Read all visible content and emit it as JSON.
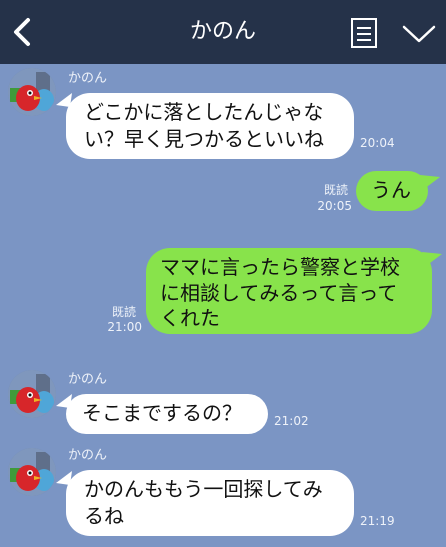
{
  "header": {
    "title": "かのん",
    "back_icon": "chevron-left-icon",
    "menu_icon": "list-icon",
    "collapse_icon": "chevron-down-icon",
    "background": "#253249"
  },
  "chat": {
    "background": "#7b95c4",
    "incoming_bubble_color": "#ffffff",
    "outgoing_bubble_color": "#88e34b",
    "messages": [
      {
        "direction": "in",
        "sender": "かのん",
        "lines": [
          "どこかに落としたんじゃな",
          "い？早く見つかるといいね"
        ],
        "time": "20:04"
      },
      {
        "direction": "out",
        "read": "既読",
        "lines": [
          "うん"
        ],
        "time": "20:05"
      },
      {
        "direction": "out",
        "read": "既読",
        "lines": [
          "ママに言ったら警察と学校",
          "に相談してみるって言って",
          "くれた"
        ],
        "time": "21:00"
      },
      {
        "direction": "in",
        "sender": "かのん",
        "lines": [
          "そこまでするの？"
        ],
        "time": "21:02"
      },
      {
        "direction": "in",
        "sender": "かのん",
        "lines": [
          "かのんももう一回探してみ",
          "るね"
        ],
        "time": "21:19"
      }
    ]
  }
}
